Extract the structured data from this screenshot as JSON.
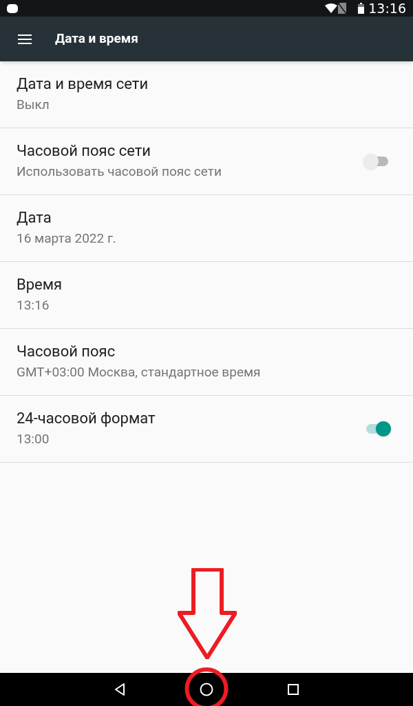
{
  "status_bar": {
    "time": "13:16"
  },
  "toolbar": {
    "title": "Дата и время"
  },
  "settings": [
    {
      "kind": "plain",
      "title": "Дата и время сети",
      "summary": "Выкл"
    },
    {
      "kind": "switch",
      "title": "Часовой пояс сети",
      "summary": "Использовать часовой пояс сети",
      "on": false
    },
    {
      "kind": "plain",
      "title": "Дата",
      "summary": "16 марта 2022 г."
    },
    {
      "kind": "plain",
      "title": "Время",
      "summary": "13:16"
    },
    {
      "kind": "plain",
      "title": "Часовой пояс",
      "summary": "GMT+03:00 Москва, стандартное время"
    },
    {
      "kind": "switch",
      "title": "24-часовой формат",
      "summary": "13:00",
      "on": true
    }
  ]
}
